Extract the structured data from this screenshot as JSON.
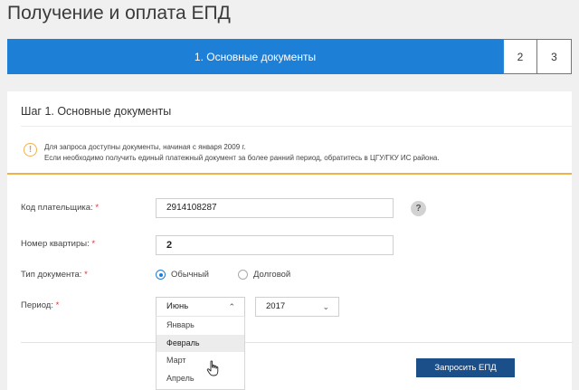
{
  "page": {
    "title": "Получение и оплата ЕПД"
  },
  "stepper": {
    "active_label": "1. Основные документы",
    "step2": "2",
    "step3": "3"
  },
  "form": {
    "heading": "Шаг 1. Основные документы",
    "notice": {
      "icon": "!",
      "line1": "Для запроса доступны документы, начиная с января 2009 г.",
      "line2": "Если необходимо получить единый платежный документ за более ранний период, обратитесь в ЦГУ/ГКУ ИС района."
    },
    "payer_code": {
      "label": "Код плательщика:",
      "value": "2914108287",
      "help": "?"
    },
    "apartment": {
      "label": "Номер квартиры:",
      "value": "2"
    },
    "doc_type": {
      "label": "Тип документа:",
      "options": [
        "Обычный",
        "Долговой"
      ],
      "selected": "Обычный"
    },
    "period": {
      "label": "Период:",
      "month": "Июнь",
      "year": "2017",
      "month_options": [
        "Январь",
        "Февраль",
        "Март",
        "Апрель"
      ],
      "hovered": "Февраль"
    },
    "required_mark": "*",
    "submit_label": "Запросить ЕПД"
  },
  "colors": {
    "accent": "#1e7fd7",
    "button": "#1b4f8a",
    "warning": "#f0b24a"
  }
}
